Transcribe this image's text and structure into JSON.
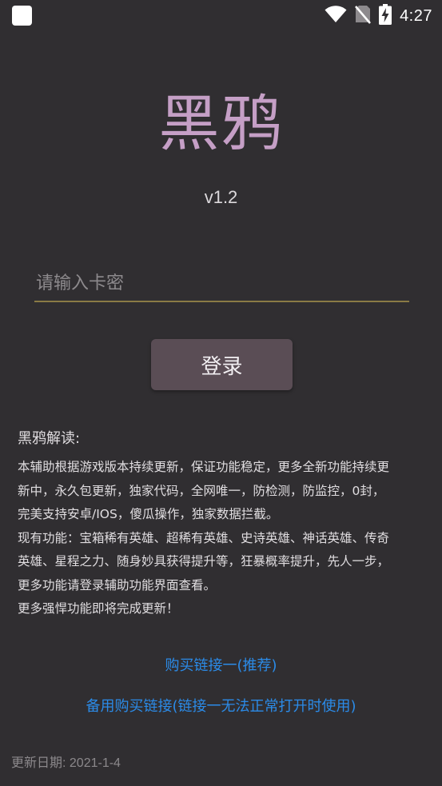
{
  "status_bar": {
    "time": "4:27",
    "icons": [
      "app-notification-icon",
      "wifi-icon",
      "no-sim-icon",
      "battery-charging-icon"
    ]
  },
  "app": {
    "title": "黑鸦",
    "version": "v1.2"
  },
  "login": {
    "card_placeholder": "请输入卡密",
    "card_value": "",
    "button_label": "登录"
  },
  "description": {
    "heading": "黑鸦解读:",
    "lines": [
      "本辅助根据游戏版本持续更新，保证功能稳定，更多全新功能持续更",
      "新中，永久包更新，独家代码，全网唯一，防检测，防监控，0封，",
      "完美支持安卓/IOS，傻瓜操作，独家数据拦截。",
      "现有功能：宝箱稀有英雄、超稀有英雄、史诗英雄、神话英雄、传奇",
      "英雄、星程之力、随身妙具获得提升等，狂暴概率提升，先人一步，",
      "更多功能请登录辅助功能界面查看。",
      "更多强悍功能即将完成更新！"
    ]
  },
  "links": {
    "primary": "购买链接一(推荐)",
    "backup": "备用购买链接(链接一无法正常打开时使用)"
  },
  "footer": {
    "update_date": "更新日期: 2021-1-4"
  },
  "colors": {
    "background": "#302e31",
    "title": "#c59fc6",
    "link": "#2b8be8",
    "button": "#5a4d55",
    "input_underline": "#8a7a45"
  }
}
